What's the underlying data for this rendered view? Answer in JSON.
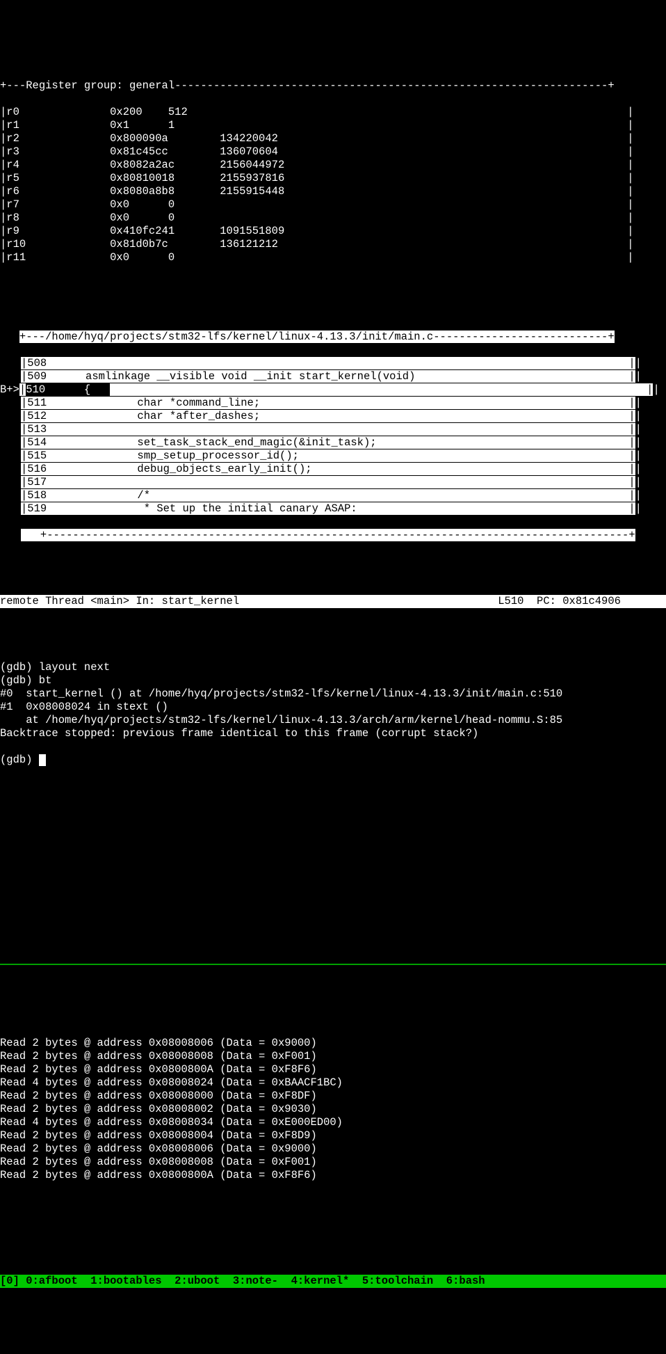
{
  "register_panel": {
    "title": "Register group: general",
    "rows": [
      {
        "name": "r0",
        "hex": "0x200",
        "dec": "512"
      },
      {
        "name": "r1",
        "hex": "0x1",
        "dec": "1"
      },
      {
        "name": "r2",
        "hex": "0x800090a",
        "dec": "134220042"
      },
      {
        "name": "r3",
        "hex": "0x81c45cc",
        "dec": "136070604"
      },
      {
        "name": "r4",
        "hex": "0x8082a2ac",
        "dec": "2156044972"
      },
      {
        "name": "r5",
        "hex": "0x80810018",
        "dec": "2155937816"
      },
      {
        "name": "r6",
        "hex": "0x8080a8b8",
        "dec": "2155915448"
      },
      {
        "name": "r7",
        "hex": "0x0",
        "dec": "0"
      },
      {
        "name": "r8",
        "hex": "0x0",
        "dec": "0"
      },
      {
        "name": "r9",
        "hex": "0x410fc241",
        "dec": "1091551809"
      },
      {
        "name": "r10",
        "hex": "0x81d0b7c",
        "dec": "136121212"
      },
      {
        "name": "r11",
        "hex": "0x0",
        "dec": "0"
      }
    ]
  },
  "source_panel": {
    "path": "/home/hyq/projects/stm32-lfs/kernel/linux-4.13.3/init/main.c",
    "breakpoint_marker": "B+>",
    "lines": [
      {
        "n": "508",
        "text": ""
      },
      {
        "n": "509",
        "text": "    asmlinkage __visible void __init start_kernel(void)"
      },
      {
        "n": "510",
        "text": "    {",
        "current": true
      },
      {
        "n": "511",
        "text": "            char *command_line;"
      },
      {
        "n": "512",
        "text": "            char *after_dashes;"
      },
      {
        "n": "513",
        "text": ""
      },
      {
        "n": "514",
        "text": "            set_task_stack_end_magic(&init_task);"
      },
      {
        "n": "515",
        "text": "            smp_setup_processor_id();"
      },
      {
        "n": "516",
        "text": "            debug_objects_early_init();"
      },
      {
        "n": "517",
        "text": ""
      },
      {
        "n": "518",
        "text": "            /*"
      },
      {
        "n": "519",
        "text": "             * Set up the initial canary ASAP:"
      }
    ]
  },
  "status_line": {
    "left": "remote Thread <main> In: start_kernel",
    "right": "L510  PC: 0x81c4906"
  },
  "gdb_console": {
    "prompt": "(gdb) ",
    "history": [
      "(gdb) layout next",
      "(gdb) bt",
      "#0  start_kernel () at /home/hyq/projects/stm32-lfs/kernel/linux-4.13.3/init/main.c:510",
      "#1  0x08008024 in stext ()",
      "    at /home/hyq/projects/stm32-lfs/kernel/linux-4.13.3/arch/arm/kernel/head-nommu.S:85",
      "Backtrace stopped: previous frame identical to this frame (corrupt stack?)"
    ]
  },
  "jlink_output": [
    "Read 2 bytes @ address 0x08008006 (Data = 0x9000)",
    "Read 2 bytes @ address 0x08008008 (Data = 0xF001)",
    "Read 2 bytes @ address 0x0800800A (Data = 0xF8F6)",
    "Read 4 bytes @ address 0x08008024 (Data = 0xBAACF1BC)",
    "Read 2 bytes @ address 0x08008000 (Data = 0xF8DF)",
    "Read 2 bytes @ address 0x08008002 (Data = 0x9030)",
    "Read 4 bytes @ address 0x08008034 (Data = 0xE000ED00)",
    "Read 2 bytes @ address 0x08008004 (Data = 0xF8D9)",
    "Read 2 bytes @ address 0x08008006 (Data = 0x9000)",
    "Read 2 bytes @ address 0x08008008 (Data = 0xF001)",
    "Read 2 bytes @ address 0x0800800A (Data = 0xF8F6)"
  ],
  "tmux": {
    "session": "[0]",
    "windows": [
      {
        "i": "0",
        "name": "afboot",
        "flag": ""
      },
      {
        "i": "1",
        "name": "bootables",
        "flag": ""
      },
      {
        "i": "2",
        "name": "uboot",
        "flag": ""
      },
      {
        "i": "3",
        "name": "note",
        "flag": "-"
      },
      {
        "i": "4",
        "name": "kernel",
        "flag": "*"
      },
      {
        "i": "5",
        "name": "toolchain",
        "flag": ""
      },
      {
        "i": "6",
        "name": "bash",
        "flag": ""
      }
    ]
  }
}
